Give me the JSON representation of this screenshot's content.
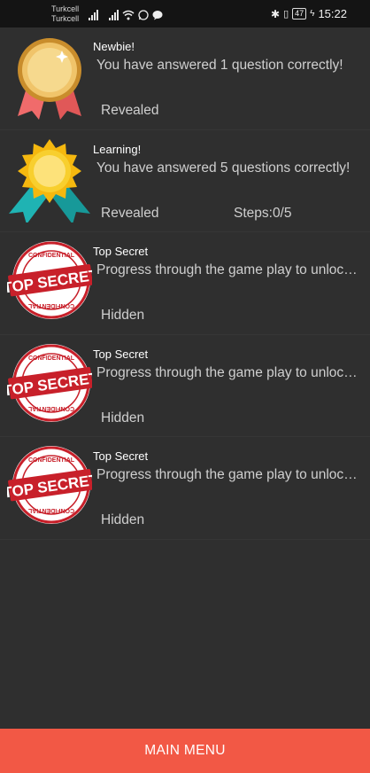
{
  "status_bar": {
    "carrier_1": "Turkcell",
    "carrier_2": "Turkcell",
    "battery": "47",
    "time": "15:22"
  },
  "achievements": [
    {
      "title": "Newbie!",
      "description": "You have answered 1 question correctly!",
      "state": "Revealed",
      "badge": "gold-medal-icon"
    },
    {
      "title": "Learning!",
      "description": "You have answered 5 questions correctly!",
      "state": "Revealed",
      "steps": "Steps:0/5",
      "badge": "sun-rosette-icon"
    },
    {
      "title": "Top Secret",
      "description": "Progress through the game play to unlock this achievement",
      "state": "Hidden",
      "badge": "top-secret-stamp-icon"
    },
    {
      "title": "Top Secret",
      "description": "Progress through the game play to unlock this achievement",
      "state": "Hidden",
      "badge": "top-secret-stamp-icon"
    },
    {
      "title": "Top Secret",
      "description": "Progress through the game play to unlock this achievement",
      "state": "Hidden",
      "badge": "top-secret-stamp-icon"
    }
  ],
  "stamp_text": {
    "main": "TOP SECRET",
    "top": "CONFIDENTIAL",
    "bottom": "CONFIDENTIAL"
  },
  "footer": {
    "main_menu_label": "MAIN MENU"
  },
  "colors": {
    "background": "#2f2f2f",
    "accent": "#f25845",
    "status_bar": "#141414"
  }
}
